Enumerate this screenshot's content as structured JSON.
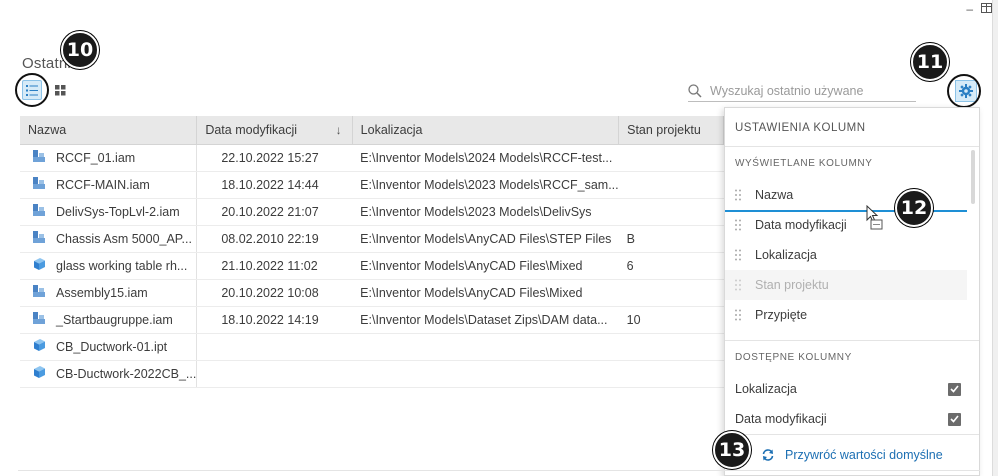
{
  "page": {
    "title": "Ostatnio"
  },
  "toolbar": {
    "list_view_icon": "list-view-icon",
    "grid_view_icon": "grid-view-icon",
    "settings_icon": "gear-icon"
  },
  "search": {
    "placeholder": "Wyszukaj ostatnio używane",
    "icon": "search-icon"
  },
  "callouts": {
    "c10": "10",
    "c11": "11",
    "c12": "12",
    "c13": "13"
  },
  "table": {
    "headers": [
      "Nazwa",
      "Data modyfikacji",
      "Lokalizacja",
      "Stan projektu"
    ],
    "rows": [
      {
        "icon": "assembly",
        "name": "RCCF_01.iam",
        "date": "22.10.2022 15:27",
        "location": "E:\\Inventor Models\\2024 Models\\RCCF-test...",
        "state": ""
      },
      {
        "icon": "assembly",
        "name": "RCCF-MAIN.iam",
        "date": "18.10.2022 14:44",
        "location": "E:\\Inventor Models\\2023 Models\\RCCF_sam...",
        "state": ""
      },
      {
        "icon": "assembly",
        "name": "DelivSys-TopLvl-2.iam",
        "date": "20.10.2022 21:07",
        "location": "E:\\Inventor Models\\2023 Models\\DelivSys",
        "state": ""
      },
      {
        "icon": "assembly",
        "name": "Chassis Asm 5000_AP...",
        "date": "08.02.2010 22:19",
        "location": "E:\\Inventor Models\\AnyCAD Files\\STEP Files",
        "state": "B"
      },
      {
        "icon": "part",
        "name": "glass working table rh...",
        "date": "21.10.2022 11:02",
        "location": "E:\\Inventor Models\\AnyCAD Files\\Mixed",
        "state": "6"
      },
      {
        "icon": "assembly",
        "name": "Assembly15.iam",
        "date": "20.10.2022 10:08",
        "location": "E:\\Inventor Models\\AnyCAD Files\\Mixed",
        "state": ""
      },
      {
        "icon": "assembly",
        "name": "_Startbaugruppe.iam",
        "date": "18.10.2022 14:19",
        "location": "E:\\Inventor Models\\Dataset Zips\\DAM data...",
        "state": "10"
      },
      {
        "icon": "part",
        "name": "CB_Ductwork-01.ipt",
        "date": "",
        "location": "",
        "state": ""
      },
      {
        "icon": "part",
        "name": "CB-Ductwork-2022CB_...",
        "date": "",
        "location": "",
        "state": ""
      }
    ]
  },
  "column_settings": {
    "title": "USTAWIENIA KOLUMN",
    "displayed_label": "WYŚWIETLANE KOLUMNY",
    "displayed": [
      "Nazwa",
      "Data modyfikacji",
      "Lokalizacja",
      "Stan projektu",
      "Przypięte"
    ],
    "available_label": "DOSTĘPNE KOLUMNY",
    "available": [
      {
        "label": "Lokalizacja",
        "checked": true
      },
      {
        "label": "Data modyfikacji",
        "checked": true
      }
    ],
    "reset_label": "Przywróć wartości domyślne"
  },
  "colors": {
    "accent": "#1e8fd5",
    "assembly_icon": "#4a83c4",
    "part_icon": "#3a8ad6",
    "callout": "#1a1a1a"
  }
}
